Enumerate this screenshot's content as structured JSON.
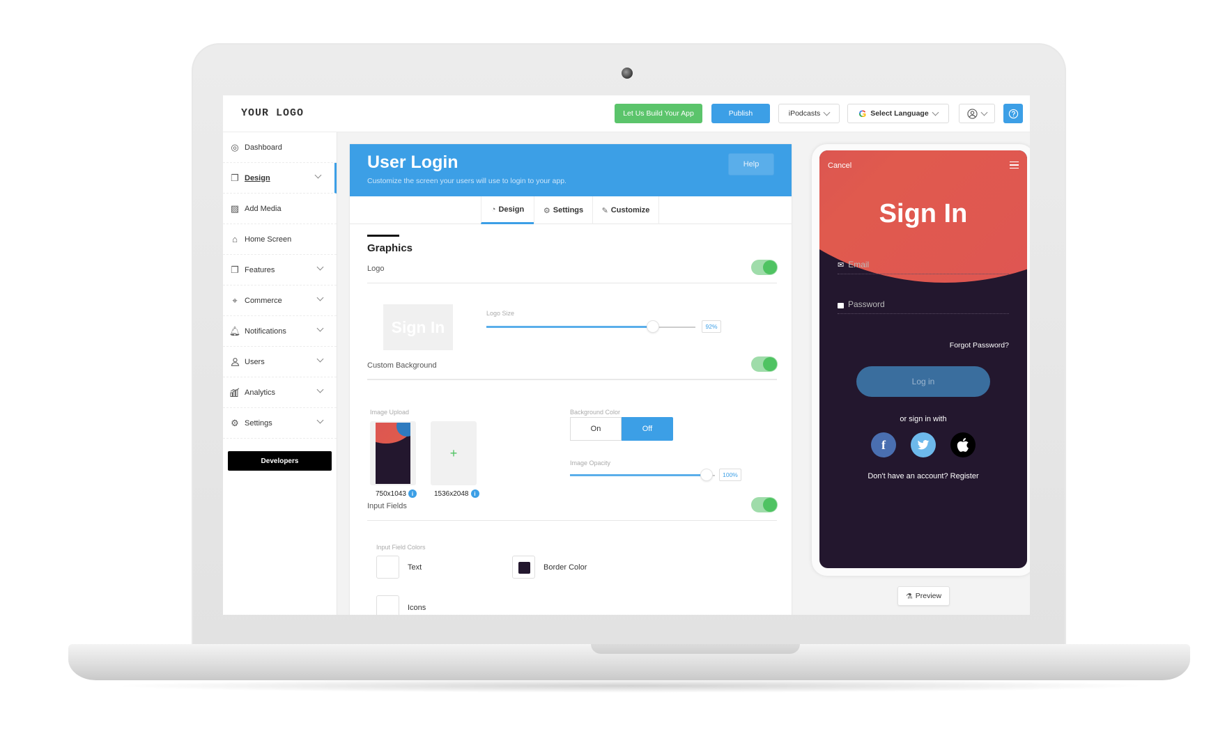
{
  "header": {
    "logo": "YOUR LOGO",
    "build_app_label": "Let Us Build Your App",
    "publish_label": "Publish",
    "app_select": "iPodcasts",
    "language_select": "Select Language",
    "user_icon": "user-circle-icon",
    "help_icon": "question-circle-icon"
  },
  "sidebar": {
    "items": [
      {
        "label": "Dashboard",
        "icon": "dashboard-icon",
        "expandable": false,
        "active": false
      },
      {
        "label": "Design",
        "icon": "design-icon",
        "expandable": true,
        "active": true
      },
      {
        "label": "Add Media",
        "icon": "image-icon",
        "expandable": false,
        "active": false
      },
      {
        "label": "Home Screen",
        "icon": "home-icon",
        "expandable": false,
        "active": false
      },
      {
        "label": "Features",
        "icon": "features-icon",
        "expandable": true,
        "active": false
      },
      {
        "label": "Commerce",
        "icon": "tag-icon",
        "expandable": true,
        "active": false
      },
      {
        "label": "Notifications",
        "icon": "bell-icon",
        "expandable": true,
        "active": false
      },
      {
        "label": "Users",
        "icon": "user-icon",
        "expandable": true,
        "active": false
      },
      {
        "label": "Analytics",
        "icon": "analytics-icon",
        "expandable": true,
        "active": false
      },
      {
        "label": "Settings",
        "icon": "gear-icon",
        "expandable": true,
        "active": false
      }
    ],
    "developers_label": "Developers"
  },
  "panel": {
    "title": "User Login",
    "subtitle": "Customize the screen your users will use to login to your app.",
    "help_label": "Help",
    "tabs": [
      {
        "label": "Design",
        "active": true
      },
      {
        "label": "Settings",
        "active": false
      },
      {
        "label": "Customize",
        "active": false
      }
    ],
    "section_title": "Graphics",
    "logo": {
      "label": "Logo",
      "enabled": true,
      "thumb_text": "Sign In",
      "size_label": "Logo Size",
      "size_value": 92,
      "size_text": "92%"
    },
    "custom_background": {
      "label": "Custom Background",
      "enabled": true,
      "image_upload_label": "Image Upload",
      "uploads": [
        {
          "dimensions": "750x1043"
        },
        {
          "dimensions": "1536x2048",
          "add_label": "+"
        }
      ],
      "background_color_label": "Background Color",
      "bg_on_label": "On",
      "bg_off_label": "Off",
      "bg_selected": "Off",
      "opacity_label": "Image Opacity",
      "opacity_value": 100,
      "opacity_text": "100%"
    },
    "input_fields": {
      "label": "Input Fields",
      "enabled": true,
      "colors_label": "Input Field Colors",
      "swatches": [
        {
          "label": "Text",
          "color": "#ffffff"
        },
        {
          "label": "Border Color",
          "color": "#23172e"
        },
        {
          "label": "Icons",
          "color": "#ffffff"
        }
      ]
    }
  },
  "phone": {
    "cancel": "Cancel",
    "title": "Sign In",
    "email_placeholder": "Email",
    "password_placeholder": "Password",
    "forgot": "Forgot Password?",
    "login": "Log in",
    "or_sign_in": "or sign in with",
    "facebook": "f",
    "twitter": "🐦",
    "apple": "",
    "register_prompt": "Don't have an account? Register",
    "colors": {
      "bg": "#23172e",
      "red": "#de5454",
      "blue": "#2b86c4",
      "button": "#3a6e9e"
    }
  },
  "preview_label": "Preview",
  "colors": {
    "accent": "#3c9fe6",
    "green": "#5bc46b",
    "toggle": "#4fc362"
  }
}
